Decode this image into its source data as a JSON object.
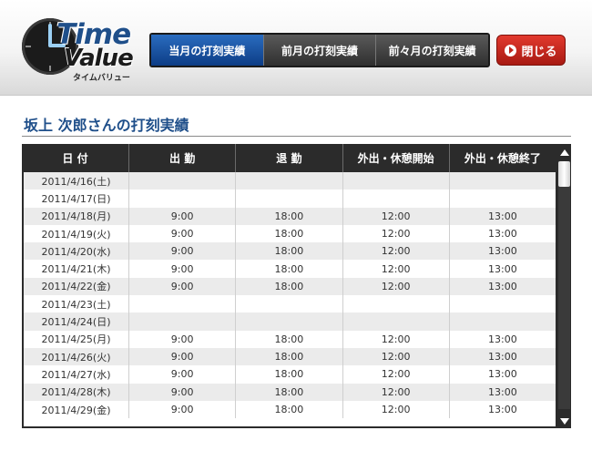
{
  "logo": {
    "word1": "Time",
    "word2": "Value",
    "sub": "タイムバリュー"
  },
  "tabs": [
    {
      "label": "当月の打刻実績",
      "active": true
    },
    {
      "label": "前月の打刻実績",
      "active": false
    },
    {
      "label": "前々月の打刻実績",
      "active": false
    }
  ],
  "close_button": {
    "label": "閉じる",
    "icon": "play-circle-icon"
  },
  "page_title": "坂上 次郎さんの打刻実績",
  "table": {
    "headers": [
      "日 付",
      "出 勤",
      "退 勤",
      "外出・休憩開始",
      "外出・休憩終了"
    ],
    "rows": [
      [
        "2011/4/16(土)",
        "",
        "",
        "",
        ""
      ],
      [
        "2011/4/17(日)",
        "",
        "",
        "",
        ""
      ],
      [
        "2011/4/18(月)",
        "9:00",
        "18:00",
        "12:00",
        "13:00"
      ],
      [
        "2011/4/19(火)",
        "9:00",
        "18:00",
        "12:00",
        "13:00"
      ],
      [
        "2011/4/20(水)",
        "9:00",
        "18:00",
        "12:00",
        "13:00"
      ],
      [
        "2011/4/21(木)",
        "9:00",
        "18:00",
        "12:00",
        "13:00"
      ],
      [
        "2011/4/22(金)",
        "9:00",
        "18:00",
        "12:00",
        "13:00"
      ],
      [
        "2011/4/23(土)",
        "",
        "",
        "",
        ""
      ],
      [
        "2011/4/24(日)",
        "",
        "",
        "",
        ""
      ],
      [
        "2011/4/25(月)",
        "9:00",
        "18:00",
        "12:00",
        "13:00"
      ],
      [
        "2011/4/26(火)",
        "9:00",
        "18:00",
        "12:00",
        "13:00"
      ],
      [
        "2011/4/27(水)",
        "9:00",
        "18:00",
        "12:00",
        "13:00"
      ],
      [
        "2011/4/28(木)",
        "9:00",
        "18:00",
        "12:00",
        "13:00"
      ],
      [
        "2011/4/29(金)",
        "9:00",
        "18:00",
        "12:00",
        "13:00"
      ]
    ]
  },
  "colors": {
    "accent_blue": "#1f4f8a",
    "active_tab": "#0d3d86",
    "close_red": "#c0241a"
  }
}
